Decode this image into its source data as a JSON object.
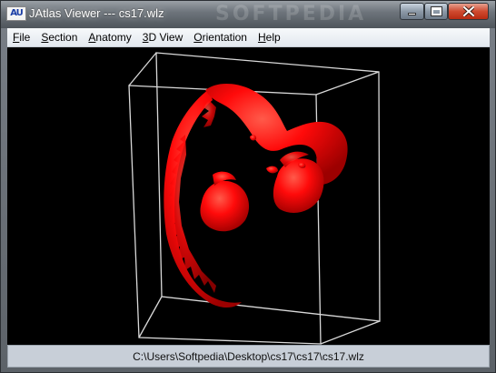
{
  "window": {
    "title": "JAtlas Viewer --- cs17.wlz",
    "icon_text": "AU",
    "background_watermark": "SOFTPEDIA"
  },
  "controls": {
    "minimize": "minimize-icon",
    "maximize": "maximize-icon",
    "close": "close-icon"
  },
  "menu": {
    "items": [
      {
        "label": "File",
        "access_key": "F"
      },
      {
        "label": "Section",
        "access_key": "S"
      },
      {
        "label": "Anatomy",
        "access_key": "A"
      },
      {
        "label": "3D View",
        "access_key": "3"
      },
      {
        "label": "Orientation",
        "access_key": "O"
      },
      {
        "label": "Help",
        "access_key": "H"
      }
    ]
  },
  "viewer": {
    "background_color": "#000000",
    "box_color": "#d9d9d9",
    "model_color": "#ff0000"
  },
  "status": {
    "path": "C:\\Users\\Softpedia\\Desktop\\cs17\\cs17\\cs17.wlz"
  }
}
